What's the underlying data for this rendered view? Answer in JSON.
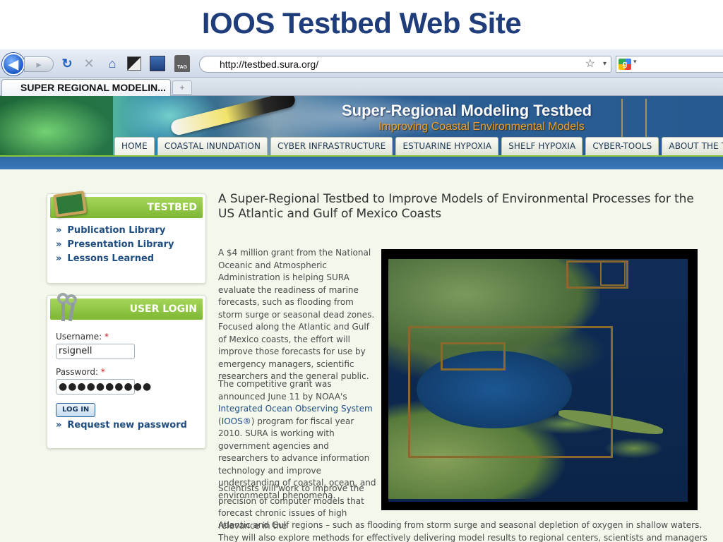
{
  "slide": {
    "title": "IOOS Testbed Web Site"
  },
  "browser": {
    "url": "http://testbed.sura.org/",
    "tab_title": "SUPER REGIONAL MODELIN...",
    "newtab_label": "+",
    "tag_label": "TAG",
    "search_engine_letter": "g"
  },
  "banner": {
    "title": "Super-Regional Modeling Testbed",
    "subtitle": "Improving Coastal Environmental Models",
    "menu": [
      "HOME",
      "COASTAL INUNDATION",
      "CYBER INFRASTRUCTURE",
      "ESTUARINE HYPOXIA",
      "SHELF HYPOXIA",
      "CYBER-TOOLS",
      "ABOUT THE TESTBED"
    ]
  },
  "sidebar": {
    "testbed": {
      "title": "TESTBED",
      "links": [
        "Publication Library",
        "Presentation Library",
        "Lessons Learned"
      ]
    },
    "login": {
      "title": "USER LOGIN",
      "username_label": "Username:",
      "username_value": "rsignell",
      "password_label": "Password:",
      "password_value": "●●●●●●●●●●",
      "required_mark": "*",
      "login_button": "LOG IN",
      "request_link": "Request new password"
    }
  },
  "main": {
    "title": "A Super-Regional Testbed to Improve Models of Environmental Processes for the US Atlantic and Gulf of Mexico Coasts",
    "para1": "A $4 million grant from the National Oceanic and Atmospheric Administration is helping  SURA  evaluate the readiness of marine forecasts, such as flooding from storm surge or seasonal dead zones. Focused along the Atlantic and Gulf of Mexico coasts, the effort will improve those forecasts  for use by emergency managers, scientific researchers and the general public.",
    "para2_a": "The competitive grant was announced June 11 by NOAA's ",
    "para2_link": "Integrated Ocean Observing System",
    "para2_b": " (",
    "para2_link2": "IOOS®",
    "para2_c": ")  program for fiscal year 2010. SURA is working with government agencies and  researchers to advance information technology and improve understanding of coastal, ocean, and  environmental phenomena.",
    "para3": "Scientists will work to improve the precision of computer models that forecast chronic issues of high  relevance in the",
    "para4": "Atlantic and Gulf regions – such as flooding from storm surge and seasonal depletion of  oxygen in shallow waters.  They will also explore methods for effectively delivering model results to  regional centers, scientists and managers relying on IOOS.  The"
  },
  "icons": {
    "back": "◀",
    "forward": "▸",
    "reload": "↻",
    "stop": "✕",
    "home": "⌂",
    "star": "☆",
    "dropdown": "▾"
  }
}
